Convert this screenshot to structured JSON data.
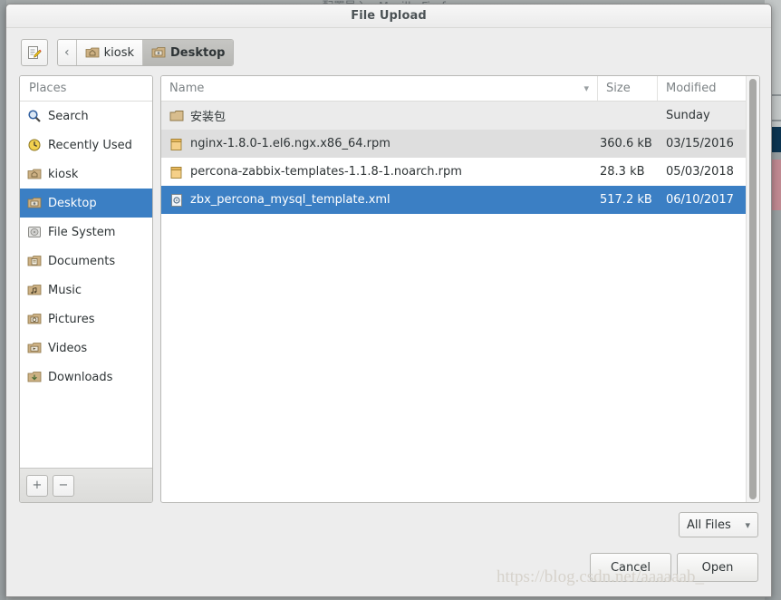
{
  "background": {
    "parent_window_title": "配置导入 - Mozilla Firefox"
  },
  "dialog": {
    "title": "File Upload"
  },
  "toolbar": {
    "type_name_button": {
      "name": "type-a-file-name",
      "icon": "edit-pencil-icon"
    },
    "back_button_label": "‹",
    "breadcrumbs": [
      {
        "label": "kiosk",
        "icon": "home-folder-icon",
        "active": false
      },
      {
        "label": "Desktop",
        "icon": "desktop-folder-icon",
        "active": true
      }
    ]
  },
  "places": {
    "header": "Places",
    "items": [
      {
        "label": "Search",
        "icon": "search-icon",
        "selected": false
      },
      {
        "label": "Recently Used",
        "icon": "recent-clock-icon",
        "selected": false
      },
      {
        "label": "kiosk",
        "icon": "home-folder-icon",
        "selected": false
      },
      {
        "label": "Desktop",
        "icon": "desktop-folder-icon",
        "selected": true
      },
      {
        "label": "File System",
        "icon": "drive-icon",
        "selected": false
      },
      {
        "label": "Documents",
        "icon": "documents-folder-icon",
        "selected": false
      },
      {
        "label": "Music",
        "icon": "music-folder-icon",
        "selected": false
      },
      {
        "label": "Pictures",
        "icon": "pictures-folder-icon",
        "selected": false
      },
      {
        "label": "Videos",
        "icon": "videos-folder-icon",
        "selected": false
      },
      {
        "label": "Downloads",
        "icon": "downloads-folder-icon",
        "selected": false
      }
    ],
    "add_bookmark_label": "+",
    "remove_bookmark_label": "−"
  },
  "filelist": {
    "columns": {
      "name": "Name",
      "size": "Size",
      "modified": "Modified"
    },
    "sort_indicator": "chevron-down-icon",
    "rows": [
      {
        "name": "安装包",
        "size": "",
        "modified": "Sunday",
        "icon": "folder-icon",
        "selected": false,
        "stripe": "odd"
      },
      {
        "name": "nginx-1.8.0-1.el6.ngx.x86_64.rpm",
        "size": "360.6 kB",
        "modified": "03/15/2016",
        "icon": "package-icon",
        "selected": false,
        "stripe": "shade"
      },
      {
        "name": "percona-zabbix-templates-1.1.8-1.noarch.rpm",
        "size": "28.3 kB",
        "modified": "05/03/2018",
        "icon": "package-icon",
        "selected": false,
        "stripe": "even"
      },
      {
        "name": "zbx_percona_mysql_template.xml",
        "size": "517.2 kB",
        "modified": "06/10/2017",
        "icon": "xml-file-icon",
        "selected": true,
        "stripe": "even"
      }
    ]
  },
  "footer": {
    "filter_value": "All Files",
    "cancel_label": "Cancel",
    "open_label": "Open"
  },
  "watermark": "https://blog.csdn.net/aaaaaab_",
  "colors": {
    "selection_blue": "#3b7fc4",
    "dialog_bg": "#ededed",
    "list_bg": "#ffffff",
    "header_text": "#7d8386"
  }
}
